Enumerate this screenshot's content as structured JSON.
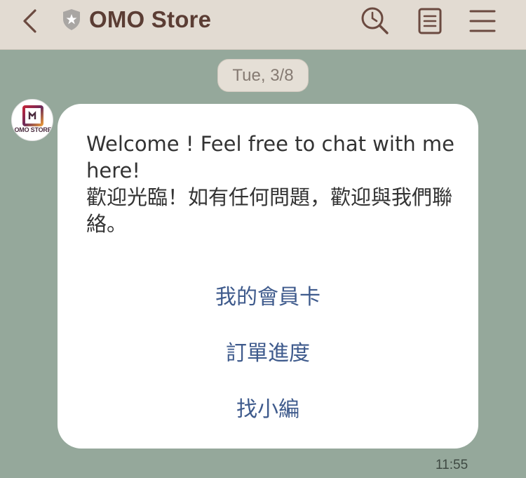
{
  "header": {
    "title": "OMO Store",
    "back_icon": "chevron-left-icon",
    "verified_icon": "shield-star-icon",
    "search_icon": "search-icon",
    "notes_icon": "notes-icon",
    "menu_icon": "menu-icon"
  },
  "chat": {
    "date_label": "Tue, 3/8",
    "sender": {
      "avatar_text": "OMO STORE"
    },
    "message": {
      "text": "Welcome ! Feel free to chat with me here!\n歡迎光臨！如有任何問題，歡迎與我們聯絡。",
      "actions": [
        "我的會員卡",
        "訂單進度",
        "找小編"
      ]
    },
    "timestamp": "11:55"
  },
  "colors": {
    "header_bg": "#e2dbd2",
    "chat_bg": "#95a89b",
    "title": "#5b3d34",
    "action_link": "#3e5a8c"
  }
}
